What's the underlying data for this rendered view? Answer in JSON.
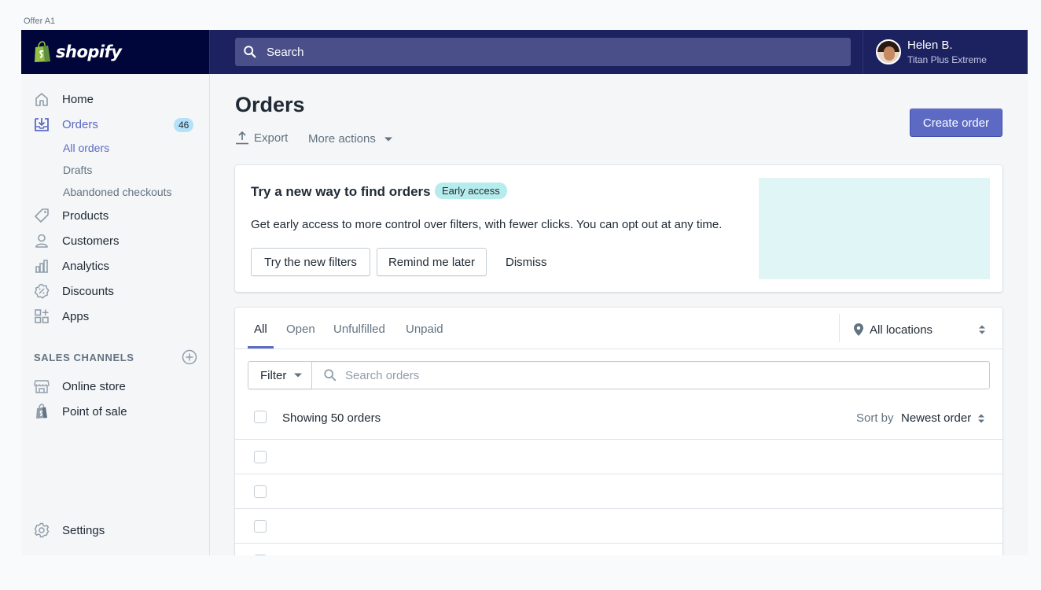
{
  "frame_label": "Offer A1",
  "brand": {
    "name": "shopify",
    "color": "#000639",
    "topbar_color": "#1c2260"
  },
  "search": {
    "placeholder": "Search"
  },
  "user": {
    "name": "Helen B.",
    "store": "Titan Plus Extreme"
  },
  "sidebar": {
    "items": [
      {
        "label": "Home",
        "icon": "home-icon"
      },
      {
        "label": "Orders",
        "icon": "orders-icon",
        "badge": "46",
        "active": true
      },
      {
        "label": "Products",
        "icon": "tag-icon"
      },
      {
        "label": "Customers",
        "icon": "person-icon"
      },
      {
        "label": "Analytics",
        "icon": "bar-chart-icon"
      },
      {
        "label": "Discounts",
        "icon": "discount-icon"
      },
      {
        "label": "Apps",
        "icon": "apps-icon"
      }
    ],
    "orders_sub": [
      "All orders",
      "Drafts",
      "Abandoned checkouts"
    ],
    "sales_channels_title": "SALES CHANNELS",
    "channels": [
      {
        "label": "Online store",
        "icon": "store-icon"
      },
      {
        "label": "Point of sale",
        "icon": "pos-icon"
      }
    ],
    "settings": "Settings"
  },
  "page": {
    "title": "Orders",
    "export": "Export",
    "more_actions": "More actions",
    "create_order": "Create order"
  },
  "promo": {
    "title": "Try a new way to find orders",
    "badge": "Early access",
    "description": "Get early access to more control over filters, with fewer clicks. You can opt out at any time.",
    "try_button": "Try the new filters",
    "remind_button": "Remind me later",
    "dismiss": "Dismiss"
  },
  "orders": {
    "tabs": [
      "All",
      "Open",
      "Unfulfilled",
      "Unpaid"
    ],
    "location": "All locations",
    "filter": "Filter",
    "search_placeholder": "Search orders",
    "showing": "Showing 50 orders",
    "sort_label": "Sort by",
    "sort_value": "Newest order"
  },
  "colors": {
    "accent": "#5c6ac4",
    "early_access_bg": "#b7ecec",
    "badge_bg": "#b4e1fa"
  }
}
